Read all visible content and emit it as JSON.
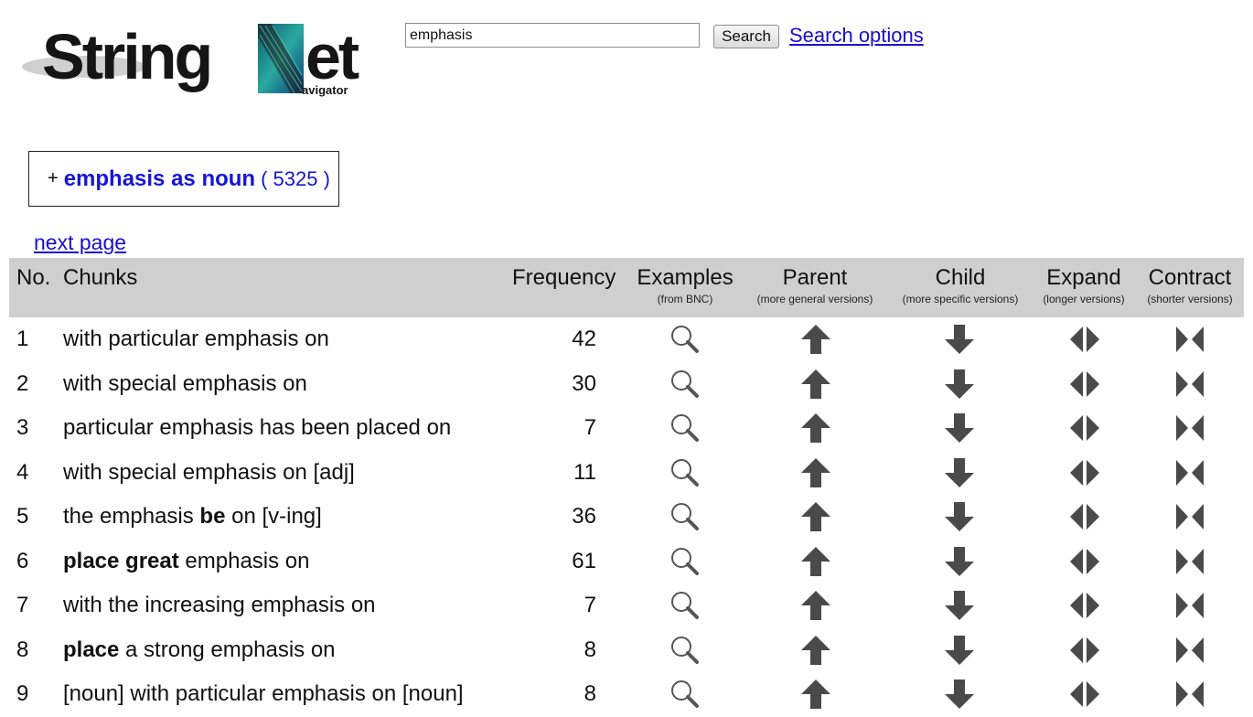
{
  "header": {
    "logo_text": "StringNet",
    "logo_subtext": "avigator",
    "search_value": "emphasis",
    "search_button": "Search",
    "search_options": "Search options"
  },
  "sense": {
    "plus": "+",
    "label": "emphasis as noun",
    "count": "( 5325 )"
  },
  "next_page": "next page",
  "table": {
    "headers": {
      "no": "No.",
      "chunks": "Chunks",
      "frequency": "Frequency",
      "examples": "Examples",
      "examples_sub": "(from BNC)",
      "parent": "Parent",
      "parent_sub": "(more general versions)",
      "child": "Child",
      "child_sub": "(more specific versions)",
      "expand": "Expand",
      "expand_sub": "(longer versions)",
      "contract": "Contract",
      "contract_sub": "(shorter versions)"
    },
    "rows": [
      {
        "no": "1",
        "chunk": [
          {
            "t": "with particular emphasis on",
            "b": false
          }
        ],
        "freq": "42"
      },
      {
        "no": "2",
        "chunk": [
          {
            "t": "with special emphasis on",
            "b": false
          }
        ],
        "freq": "30"
      },
      {
        "no": "3",
        "chunk": [
          {
            "t": "particular emphasis has been placed on",
            "b": false
          }
        ],
        "freq": "7"
      },
      {
        "no": "4",
        "chunk": [
          {
            "t": "with special emphasis on [adj]",
            "b": false
          }
        ],
        "freq": "11"
      },
      {
        "no": "5",
        "chunk": [
          {
            "t": "the emphasis ",
            "b": false
          },
          {
            "t": "be",
            "b": true
          },
          {
            "t": " on [v-ing]",
            "b": false
          }
        ],
        "freq": "36"
      },
      {
        "no": "6",
        "chunk": [
          {
            "t": "place great",
            "b": true
          },
          {
            "t": " emphasis on",
            "b": false
          }
        ],
        "freq": "61"
      },
      {
        "no": "7",
        "chunk": [
          {
            "t": "with the increasing emphasis on",
            "b": false
          }
        ],
        "freq": "7"
      },
      {
        "no": "8",
        "chunk": [
          {
            "t": "place",
            "b": true
          },
          {
            "t": " a strong emphasis on",
            "b": false
          }
        ],
        "freq": "8"
      },
      {
        "no": "9",
        "chunk": [
          {
            "t": "[noun] with particular emphasis on [noun]",
            "b": false
          }
        ],
        "freq": "8"
      }
    ],
    "icons": [
      "magnifier-icon",
      "up-arrow-icon",
      "down-arrow-icon",
      "expand-icon",
      "contract-icon"
    ]
  },
  "colors": {
    "link": "#1a0dcc",
    "sense": "#1515d8",
    "header_bg": "#cfcfcf",
    "icon": "#4a4a4a"
  }
}
